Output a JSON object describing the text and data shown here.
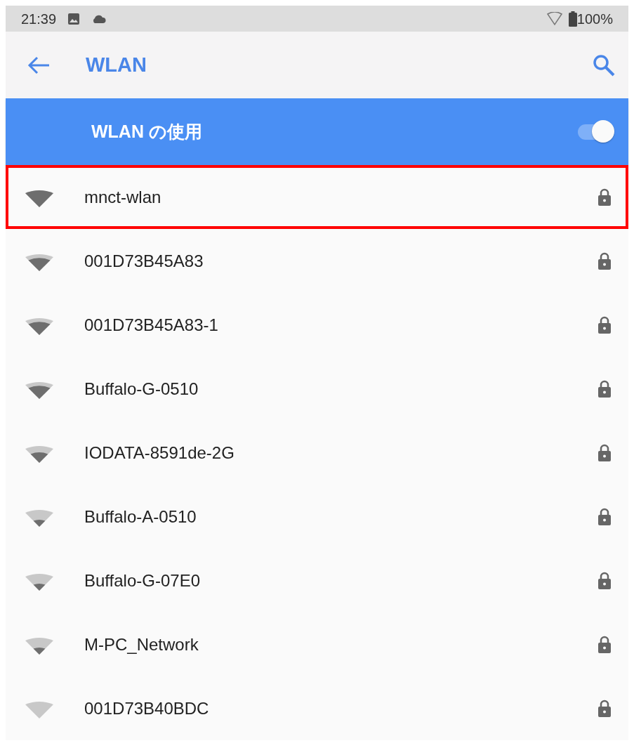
{
  "status_bar": {
    "time": "21:39",
    "battery": "100%"
  },
  "app_bar": {
    "title": "WLAN"
  },
  "wlan_toggle": {
    "label": "WLAN の使用",
    "on": true
  },
  "networks": [
    {
      "name": "mnct-wlan",
      "kind": "full",
      "locked": true,
      "highlighted": true
    },
    {
      "name": "001D73B45A83",
      "kind": "high",
      "locked": true,
      "highlighted": false
    },
    {
      "name": "001D73B45A83-1",
      "kind": "high",
      "locked": true,
      "highlighted": false
    },
    {
      "name": "Buffalo-G-0510",
      "kind": "high",
      "locked": true,
      "highlighted": false
    },
    {
      "name": "IODATA-8591de-2G",
      "kind": "medium",
      "locked": true,
      "highlighted": false
    },
    {
      "name": "Buffalo-A-0510",
      "kind": "low",
      "locked": true,
      "highlighted": false
    },
    {
      "name": "Buffalo-G-07E0",
      "kind": "low",
      "locked": true,
      "highlighted": false
    },
    {
      "name": "M-PC_Network",
      "kind": "low",
      "locked": true,
      "highlighted": false
    },
    {
      "name": "001D73B40BDC",
      "kind": "none",
      "locked": true,
      "highlighted": false
    }
  ]
}
